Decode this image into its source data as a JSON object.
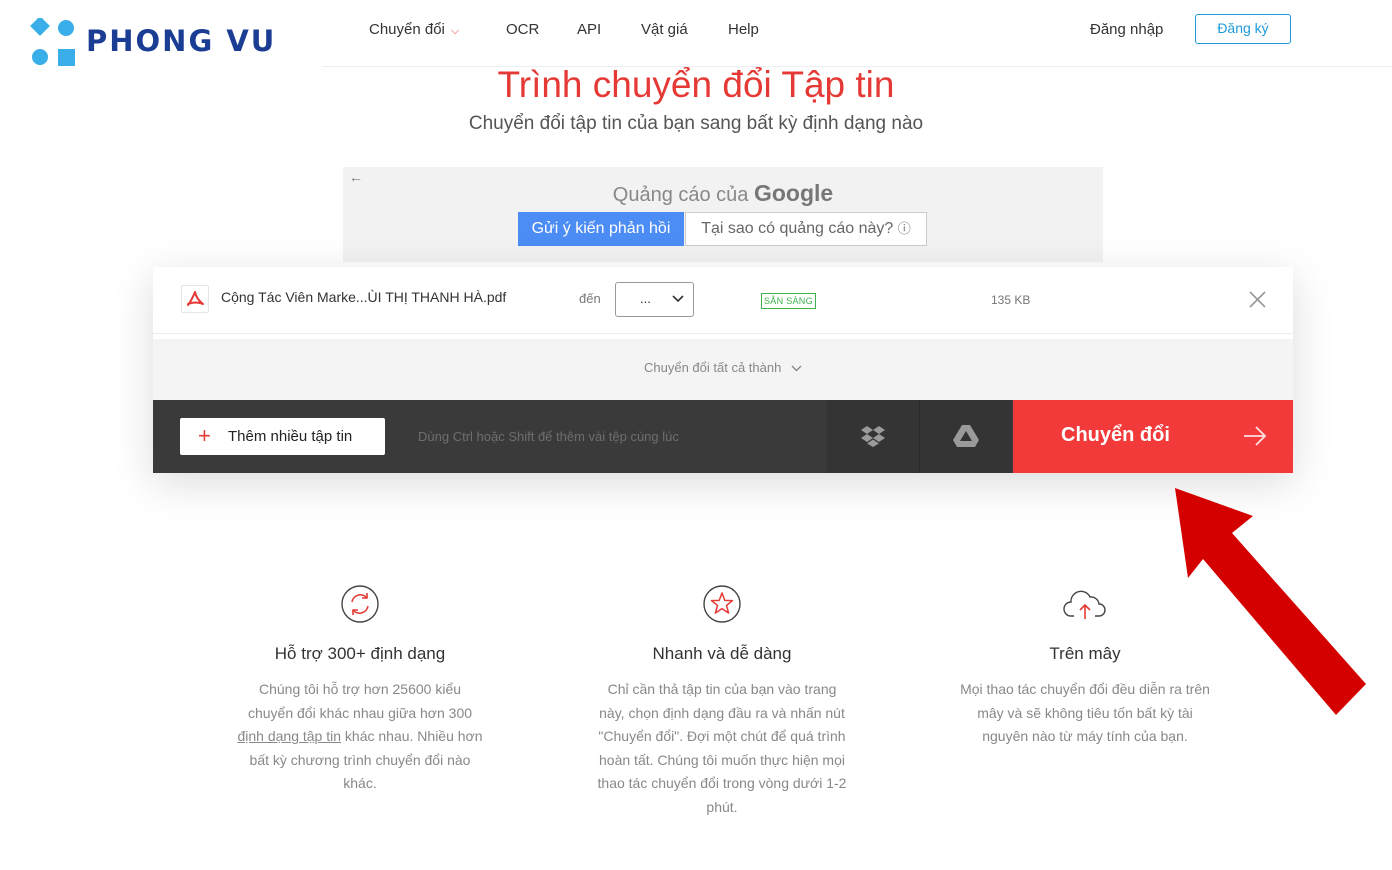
{
  "brand": {
    "name": "PHONG VU"
  },
  "nav": {
    "items": [
      {
        "label": "Chuyển đổi",
        "has_dropdown": true
      },
      {
        "label": "OCR"
      },
      {
        "label": "API"
      },
      {
        "label": "Vật giá"
      },
      {
        "label": "Help"
      }
    ],
    "login": "Đăng nhập",
    "signup": "Đăng ký"
  },
  "hero": {
    "title": "Trình chuyển đổi Tập tin",
    "subtitle": "Chuyển đổi tập tin của bạn sang bất kỳ định dạng nào"
  },
  "ad": {
    "label_prefix": "Quảng cáo của",
    "label_brand": "Google",
    "feedback_button": "Gửi ý kiến phản hồi",
    "why_button": "Tại sao có quảng cáo này?",
    "why_icon": "ⓘ"
  },
  "file": {
    "name": "Cộng Tác Viên Marke...ÙI THỊ THANH HÀ.pdf",
    "to_label": "đến",
    "format_value": "...",
    "status": "SẴN SÀNG",
    "size": "135 KB"
  },
  "converter": {
    "convert_all": "Chuyển đổi tất cả thành",
    "add_more": "Thêm nhiều tập tin",
    "hint": "Dùng Ctrl hoặc Shift để thêm vài tệp cùng lúc",
    "convert_button": "Chuyển đổi"
  },
  "features": [
    {
      "title": "Hỗ trợ 300+ định dạng",
      "desc_before": "Chúng tôi hỗ trợ hơn 25600 kiểu chuyển đổi khác nhau giữa hơn 300",
      "desc_link": "định dạng tập tin",
      "desc_after": "khác nhau. Nhiều hơn bất kỳ chương trình chuyển đổi nào khác."
    },
    {
      "title": "Nhanh và dễ dàng",
      "desc": "Chỉ cần thả tập tin của bạn vào trang này, chọn định dạng đầu ra và nhấn nút \"Chuyển đổi\". Đợi một chút để quá trình hoàn tất. Chúng tôi muốn thực hiện mọi thao tác chuyển đổi trong vòng dưới 1-2 phút."
    },
    {
      "title": "Trên mây",
      "desc": "Mọi thao tác chuyển đổi đều diễn ra trên mây và sẽ không tiêu tốn bất kỳ tài nguyên nào từ máy tính của bạn."
    }
  ],
  "colors": {
    "accent_red": "#f23a3a",
    "title_red": "#e53935",
    "brand_blue": "#1b3d94",
    "logo_cyan": "#3aaee8",
    "ready_green": "#3bb34a",
    "signup_blue": "#1e9bd7",
    "ad_blue": "#4b8cf5"
  },
  "icons": {
    "logo": "phongvu-logo-icon",
    "file_type": "pdf-icon",
    "dropbox": "dropbox-icon",
    "gdrive": "google-drive-icon",
    "remove": "close-icon",
    "feature_1": "refresh-circle-icon",
    "feature_2": "star-circle-icon",
    "feature_3": "cloud-upload-icon"
  }
}
